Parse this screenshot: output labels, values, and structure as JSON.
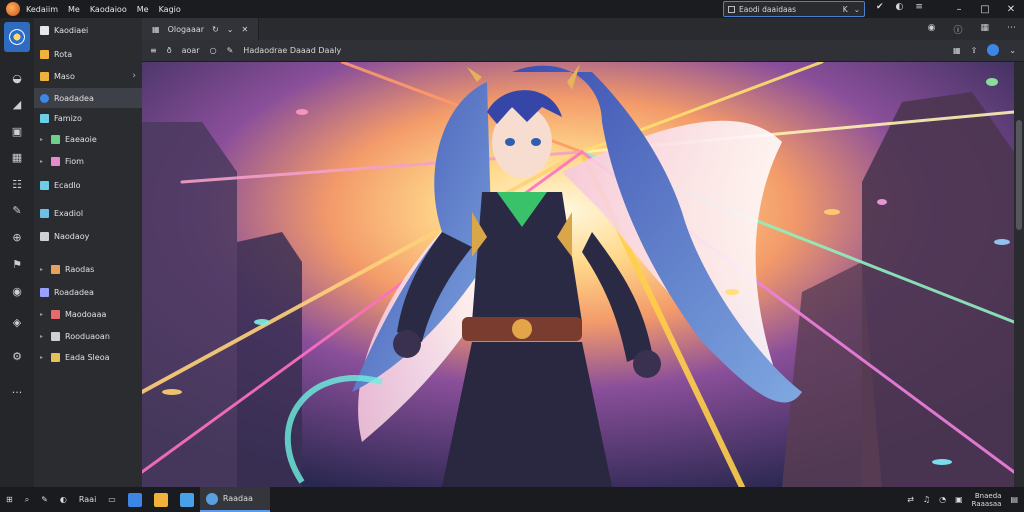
{
  "titlebar": {
    "menu": [
      "Kedaiim",
      "Me",
      "Kaodaioo",
      "Me",
      "Kagio"
    ],
    "search_text": "Eaodi daaidaas",
    "search_suffix": "K",
    "window_controls": [
      "–",
      "□",
      "✕"
    ]
  },
  "rail": {
    "items": [
      "ring-icon",
      "chart-icon",
      "image-icon",
      "grid-icon",
      "list-icon",
      "edit-icon",
      "globe-icon",
      "flag-icon",
      "shield-icon",
      "layers-icon",
      "settings-icon",
      "more-icon"
    ],
    "more": "···"
  },
  "sidebar": {
    "items": [
      {
        "label": "Kaodiaei",
        "color": "#e8e8e8"
      },
      {
        "label": "Rota",
        "color": "#f0b23a"
      },
      {
        "label": "Maso",
        "color": "#f0b23a"
      },
      {
        "label": "Roadadea",
        "color": "#3d86e6"
      },
      {
        "label": "Famizo",
        "color": "#6dcfe6"
      },
      {
        "label": "Eaeaoie",
        "color": "#6dcf8a"
      },
      {
        "label": "Fiom",
        "color": "#e88ad0"
      },
      {
        "label": "Ecadlo",
        "color": "#6dcfe6"
      },
      {
        "label": "Exadiol",
        "color": "#6dc0e6"
      },
      {
        "label": "Naodaoy",
        "color": "#d0d0d0"
      },
      {
        "label": "Raodas",
        "color": "#e8a060"
      },
      {
        "label": "Roadadea",
        "color": "#9aa0ff"
      },
      {
        "label": "Maodoaaa",
        "color": "#e86a6a"
      },
      {
        "label": "Rooduaoan",
        "color": "#d0d0d0"
      },
      {
        "label": "Eada Sleoa",
        "color": "#e8c05a"
      }
    ]
  },
  "tabbar": {
    "tab_label": "Ologaaar",
    "tab_suffix": "✕"
  },
  "toolbar": {
    "items": [
      "≡",
      "ð",
      "aoar",
      "○"
    ],
    "breadcrumb": "Hadaodrae Daaad Daaly"
  },
  "taskbar": {
    "search_label": "Raai",
    "active_label": "Raadaa",
    "clock_line1": "Bnaeda",
    "clock_line2": "Raaasaa"
  },
  "colors": {
    "accent": "#3d86e6",
    "active_item": "#3e4047"
  }
}
